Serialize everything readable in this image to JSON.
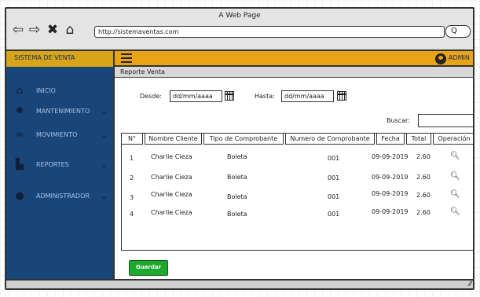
{
  "browser": {
    "page_title": "A Web Page",
    "url": "http://sistemaventas.com",
    "icons": [
      "back-arrow-icon",
      "forward-arrow-icon",
      "close-icon",
      "home-icon",
      "search-icon"
    ]
  },
  "app": {
    "brand": "SISTEMA DE VENTA",
    "user_label": "ADMIN",
    "colors": {
      "topbar": "#e8a317",
      "sidebar": "#18457a",
      "save_button": "#1fa82e"
    }
  },
  "sidebar": {
    "items": [
      {
        "label": "INICIO",
        "icon": "home-icon"
      },
      {
        "label": "MANTENIMIENTO",
        "icon": "gear-icon"
      },
      {
        "label": "MOVIMIENTO",
        "icon": "link-icon"
      },
      {
        "label": "REPORTES",
        "icon": "document-icon"
      },
      {
        "label": "ADMINISTRADOR",
        "icon": "user-icon"
      }
    ]
  },
  "content": {
    "breadcrumb": "Reporte Venta",
    "desde_label": "Desde:",
    "desde_value": "dd/mm/aaaa",
    "hasta_label": "Hasta:",
    "hasta_value": "dd/mm/aaaa",
    "buscar_label": "Buscar:",
    "save_label": "Guardar"
  },
  "table": {
    "headers": [
      "N°",
      "Nombre Cliente",
      "Tipo de Comprobante",
      "Numero de Comprobante",
      "Fecha",
      "Total",
      "Operación"
    ],
    "rows": [
      [
        "1",
        "Charlie Cieza",
        "Boleta",
        "001",
        "09-09-2019",
        "2.60"
      ],
      [
        "2",
        "Charlie Cieza",
        "Boleta",
        "001",
        "09-09-2019",
        "2.60"
      ],
      [
        "3",
        "Charlie Cieza",
        "Boleta",
        "001",
        "09-09-2019",
        "2.60"
      ],
      [
        "4",
        "Charlie Cieza",
        "Boleta",
        "001",
        "09-09-2019",
        "2.60"
      ]
    ]
  }
}
